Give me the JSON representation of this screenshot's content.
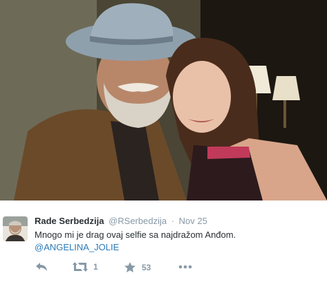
{
  "tweet": {
    "author_name": "Rade Serbedzija",
    "handle": "@RSerbedzija",
    "separator": "·",
    "date": "Nov 25",
    "text": "Mnogo mi je drag ovaj selfie sa najdražom Anđom.",
    "mention": "@ANGELINA_JOLIE",
    "retweet_count": "1",
    "favorite_count": "53"
  },
  "icons": {
    "reply": "reply-icon",
    "retweet": "retweet-icon",
    "favorite": "star-icon",
    "more": "more-icon"
  },
  "colors": {
    "link": "#2b7bb9",
    "meta": "#8899a6",
    "text": "#292f33"
  }
}
